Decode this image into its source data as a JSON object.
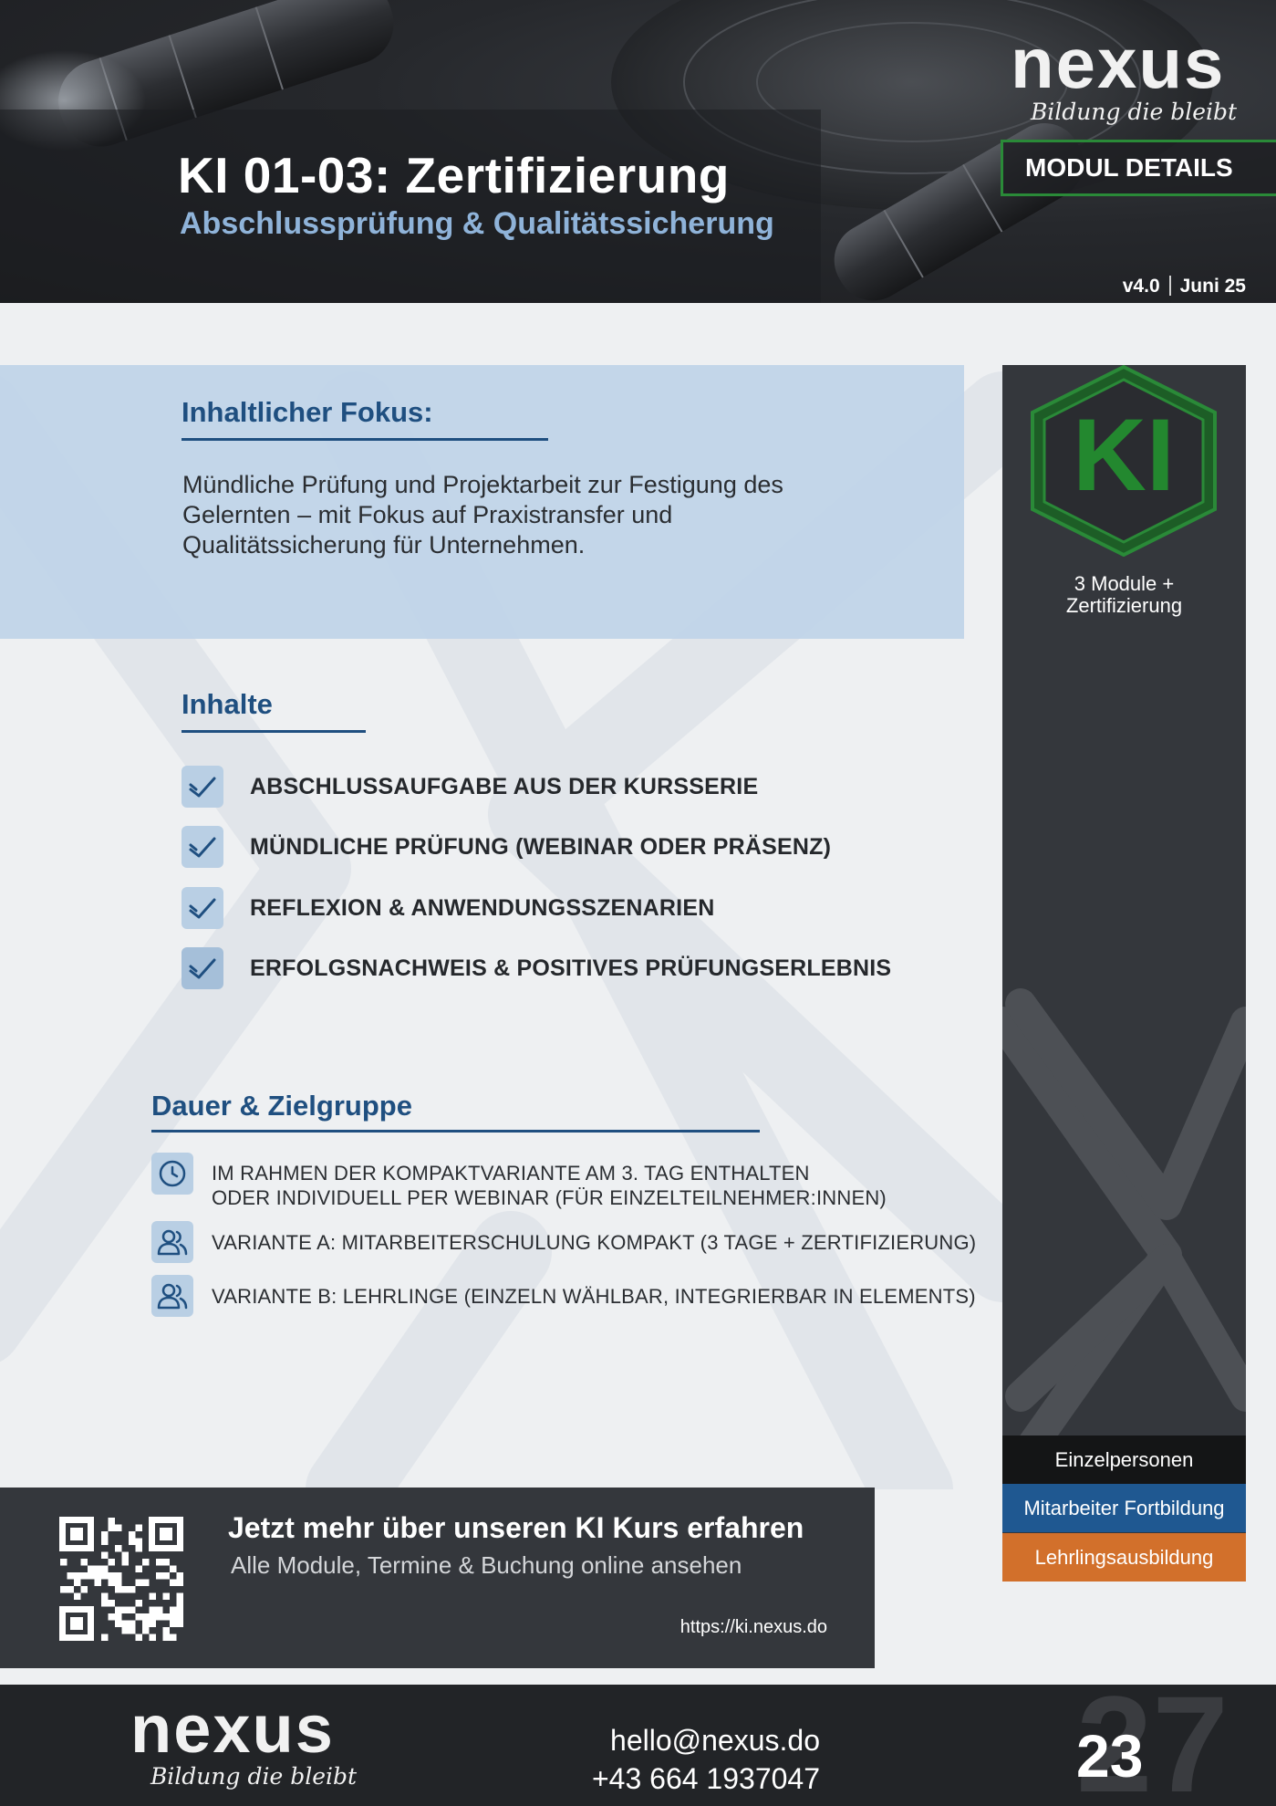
{
  "header": {
    "title": "KI 01-03: Zertifizierung",
    "subtitle": "Abschlussprüfung & Qualitätssicherung",
    "logo_word": "nexus",
    "logo_tagline": "Bildung die bleibt",
    "badge": "MODUL DETAILS",
    "version": "v4.0",
    "date": "Juni 25"
  },
  "focus": {
    "heading": "Inhaltlicher Fokus:",
    "text": "Mündliche Prüfung und Projektarbeit zur Festigung des Gelernten – mit Fokus auf Praxistransfer und Qualitätssicherung für Unternehmen."
  },
  "inhalte": {
    "heading": "Inhalte",
    "items": [
      "ABSCHLUSSAUFGABE AUS DER KURSSERIE",
      "MÜNDLICHE PRÜFUNG (WEBINAR ODER PRÄSENZ)",
      "REFLEXION & ANWENDUNGSSZENARIEN",
      "ERFOLGSNACHWEIS & POSITIVES PRÜFUNGSERLEBNIS"
    ]
  },
  "dauer": {
    "heading": "Dauer & Zielgruppe",
    "items": [
      {
        "icon": "clock-icon",
        "line1": "IM RAHMEN DER KOMPAKTVARIANTE AM 3. TAG ENTHALTEN",
        "line2": "ODER INDIVIDUELL PER WEBINAR (FÜR EINZELTEILNEHMER:INNEN)"
      },
      {
        "icon": "users-icon",
        "line1": "VARIANTE A: MITARBEITERSCHULUNG KOMPAKT (3 TAGE + ZERTIFIZIERUNG)"
      },
      {
        "icon": "users-icon",
        "line1": "VARIANTE B: LEHRLINGE (EINZELN WÄHLBAR, INTEGRIERBAR IN ELEMENTS)"
      }
    ]
  },
  "sidebar": {
    "badge_text": "KI",
    "caption_line1": "3 Module +",
    "caption_line2": "Zertifizierung",
    "tags": [
      "Einzelpersonen",
      "Mitarbeiter Fortbildung",
      "Lehrlingsausbildung"
    ]
  },
  "cta": {
    "title": "Jetzt mehr über unseren KI Kurs erfahren",
    "subtitle": "Alle Module, Termine & Buchung online ansehen",
    "url": "https://ki.nexus.do"
  },
  "footer": {
    "logo_word": "nexus",
    "logo_tagline": "Bildung die bleibt",
    "email": "hello@nexus.do",
    "phone": "+43 664 1937047",
    "page_number": "23",
    "ghost_number": "27"
  },
  "colors": {
    "accent_blue": "#1f4f80",
    "subtitle_blue": "#8fb3d9",
    "ki_green": "#2a8a38",
    "tag_orange": "#d2702b",
    "tag_blue": "#1f5891",
    "dark_panel": "#34373c"
  }
}
